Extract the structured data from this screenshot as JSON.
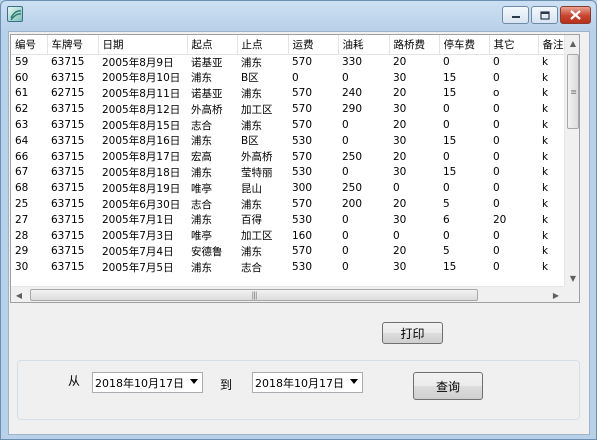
{
  "window": {
    "title": ""
  },
  "grid": {
    "columns": [
      "编号",
      "车牌号",
      "日期",
      "起点",
      "止点",
      "运费",
      "油耗",
      "路桥费",
      "停车费",
      "其它",
      "备注"
    ],
    "rows": [
      [
        "59",
        "63715",
        "2005年8月9日",
        "诺基亚",
        "浦东",
        "570",
        "330",
        "20",
        "0",
        "0",
        "k"
      ],
      [
        "60",
        "63715",
        "2005年8月10日",
        "浦东",
        "B区",
        "0",
        "0",
        "30",
        "15",
        "0",
        "k"
      ],
      [
        "61",
        "62715",
        "2005年8月11日",
        "诺基亚",
        "浦东",
        "570",
        "240",
        "20",
        "15",
        "o",
        "k"
      ],
      [
        "62",
        "63715",
        "2005年8月12日",
        "外高桥",
        "加工区",
        "570",
        "290",
        "30",
        "0",
        "0",
        "k"
      ],
      [
        "63",
        "63715",
        "2005年8月15日",
        "志合",
        "浦东",
        "570",
        "0",
        "20",
        "0",
        "0",
        "k"
      ],
      [
        "64",
        "63715",
        "2005年8月16日",
        "浦东",
        "B区",
        "530",
        "0",
        "30",
        "15",
        "0",
        "k"
      ],
      [
        "66",
        "63715",
        "2005年8月17日",
        "宏高",
        "外高桥",
        "570",
        "250",
        "20",
        "0",
        "0",
        "k"
      ],
      [
        "67",
        "63715",
        "2005年8月18日",
        "浦东",
        "莹特丽",
        "530",
        "0",
        "30",
        "15",
        "0",
        "k"
      ],
      [
        "68",
        "63715",
        "2005年8月19日",
        "唯亭",
        "昆山",
        "300",
        "250",
        "0",
        "0",
        "0",
        "k"
      ],
      [
        "25",
        "63715",
        "2005年6月30日",
        "志合",
        "浦东",
        "570",
        "200",
        "20",
        "5",
        "0",
        "k"
      ],
      [
        "27",
        "63715",
        "2005年7月1日",
        "浦东",
        "百得",
        "530",
        "0",
        "30",
        "6",
        "20",
        "k"
      ],
      [
        "28",
        "63715",
        "2005年7月3日",
        "唯亭",
        "加工区",
        "160",
        "0",
        "0",
        "0",
        "0",
        "k"
      ],
      [
        "29",
        "63715",
        "2005年7月4日",
        "安德鲁",
        "浦东",
        "570",
        "0",
        "20",
        "5",
        "0",
        "k"
      ],
      [
        "30",
        "63715",
        "2005年7月5日",
        "浦东",
        "志合",
        "530",
        "0",
        "30",
        "15",
        "0",
        "k"
      ]
    ]
  },
  "buttons": {
    "print_label": "打印",
    "query_label": "查询"
  },
  "filter": {
    "from_label": "从",
    "to_label": "到",
    "from_date": "2018年10月17日",
    "to_date": "2018年10月17日"
  }
}
